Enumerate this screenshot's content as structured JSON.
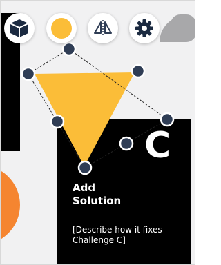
{
  "toolbar": {
    "items": [
      {
        "name": "shape-3d-icon"
      },
      {
        "name": "color-fill-icon"
      },
      {
        "name": "flip-icon"
      },
      {
        "name": "settings-icon"
      }
    ]
  },
  "colors": {
    "canvas": "#f1f1f2",
    "card": "#000000",
    "triangle": "#fbbd38",
    "orange_circle": "#f58530",
    "grey_shape": "#a8a8aa",
    "fill_swatch": "#fbbd38",
    "cube": "#1b2a41",
    "handle": "#2f3d55"
  },
  "card": {
    "letter": "C",
    "title_line1": "Add",
    "title_line2": "Solution",
    "description": "[Describe how it fixes Challenge C]"
  }
}
